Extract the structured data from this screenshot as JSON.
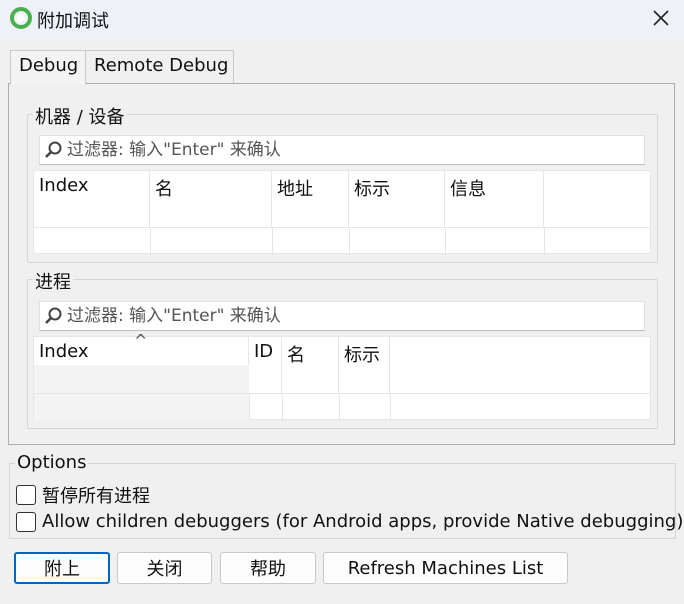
{
  "window": {
    "title": "附加调试"
  },
  "tabs": [
    {
      "label": "Debug"
    },
    {
      "label": "Remote Debug"
    }
  ],
  "machines": {
    "group_label": "机器 / 设备",
    "filter_placeholder": "过滤器: 输入\"Enter\" 来确认",
    "columns": [
      "Index",
      "名",
      "地址",
      "标示",
      "信息"
    ]
  },
  "processes": {
    "group_label": "进程",
    "filter_placeholder": "过滤器: 输入\"Enter\" 来确认",
    "columns": [
      "Index",
      "ID",
      "名",
      "标示"
    ],
    "sort_indicator": "^"
  },
  "options": {
    "label": "Options",
    "pause_all": "暂停所有进程",
    "allow_children": "Allow children debuggers (for Android apps, provide Native debugging)"
  },
  "buttons": {
    "attach": "附上",
    "close": "关闭",
    "help": "帮助",
    "refresh": "Refresh Machines List"
  },
  "colors": {
    "accent": "#0067c0",
    "app_icon": "#4caf50"
  }
}
